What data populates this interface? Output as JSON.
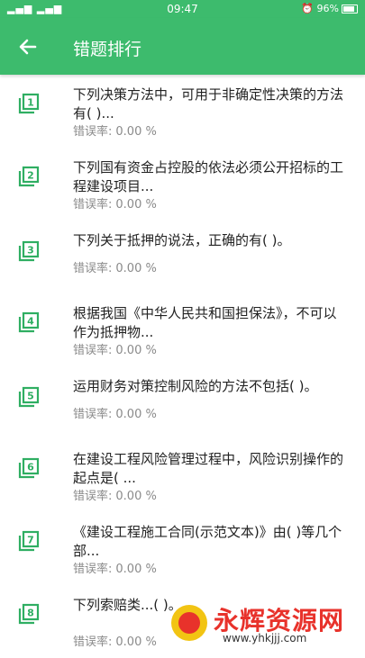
{
  "status_bar": {
    "signal": "▂▄▆ ▂▄▆",
    "time": "09:47",
    "battery": "96%"
  },
  "header": {
    "title": "错题排行"
  },
  "items": [
    {
      "num": "1",
      "title": "下列决策方法中，可用于非确定性决策的方法有( )...",
      "rate_label": "错误率:",
      "rate": "0.00 %"
    },
    {
      "num": "2",
      "title": "下列国有资金占控股的依法必须公开招标的工程建设项目...",
      "rate_label": "错误率:",
      "rate": "0.00 %"
    },
    {
      "num": "3",
      "title": "下列关于抵押的说法，正确的有( )。",
      "rate_label": "错误率:",
      "rate": "0.00 %"
    },
    {
      "num": "4",
      "title": "根据我国《中华人民共和国担保法》，不可以作为抵押物...",
      "rate_label": "错误率:",
      "rate": "0.00 %"
    },
    {
      "num": "5",
      "title": "运用财务对策控制风险的方法不包括( )。",
      "rate_label": "错误率:",
      "rate": "0.00 %"
    },
    {
      "num": "6",
      "title": "在建设工程风险管理过程中，风险识别操作的起点是( ...",
      "rate_label": "错误率:",
      "rate": "0.00 %"
    },
    {
      "num": "7",
      "title": "《建设工程施工合同(示范文本)》由( )等几个部...",
      "rate_label": "错误率:",
      "rate": "0.00 %"
    },
    {
      "num": "8",
      "title": "下列索赔类...( )。",
      "rate_label": "错误率:",
      "rate": "0.00 %"
    }
  ],
  "watermark": {
    "text": "永辉资源网",
    "url": "www.yhkjjj.com"
  },
  "colors": {
    "primary": "#3dbb6d",
    "icon": "#2fae62",
    "rate_text": "#8a8a8a"
  }
}
